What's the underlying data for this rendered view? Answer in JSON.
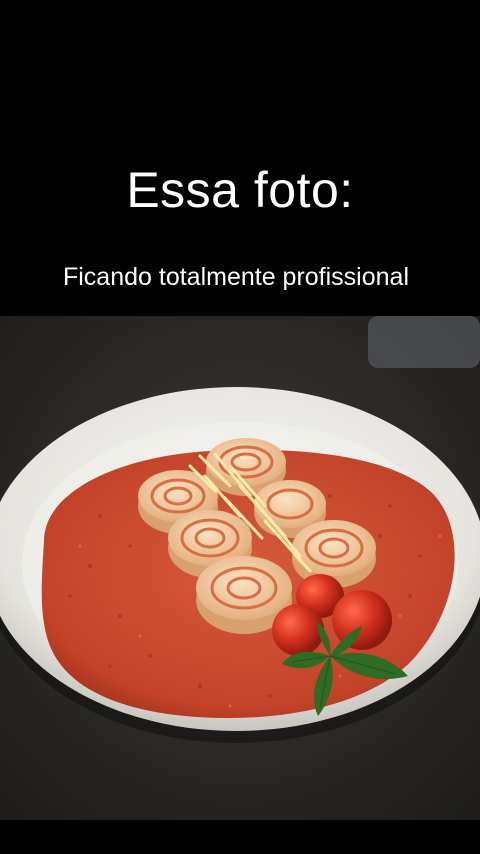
{
  "overlay": {
    "title": "Essa foto:",
    "subtitle": "Ficando totalmente profissional"
  },
  "photo": {
    "subject": "pasta-rolls-in-tomato-sauce",
    "colors": {
      "background": "#2b2926",
      "plate": "#ecebe7",
      "sauce": "#c8452a",
      "pasta": "#f0c9a0",
      "tomato": "#c8281c",
      "basil": "#2f6b22"
    }
  }
}
